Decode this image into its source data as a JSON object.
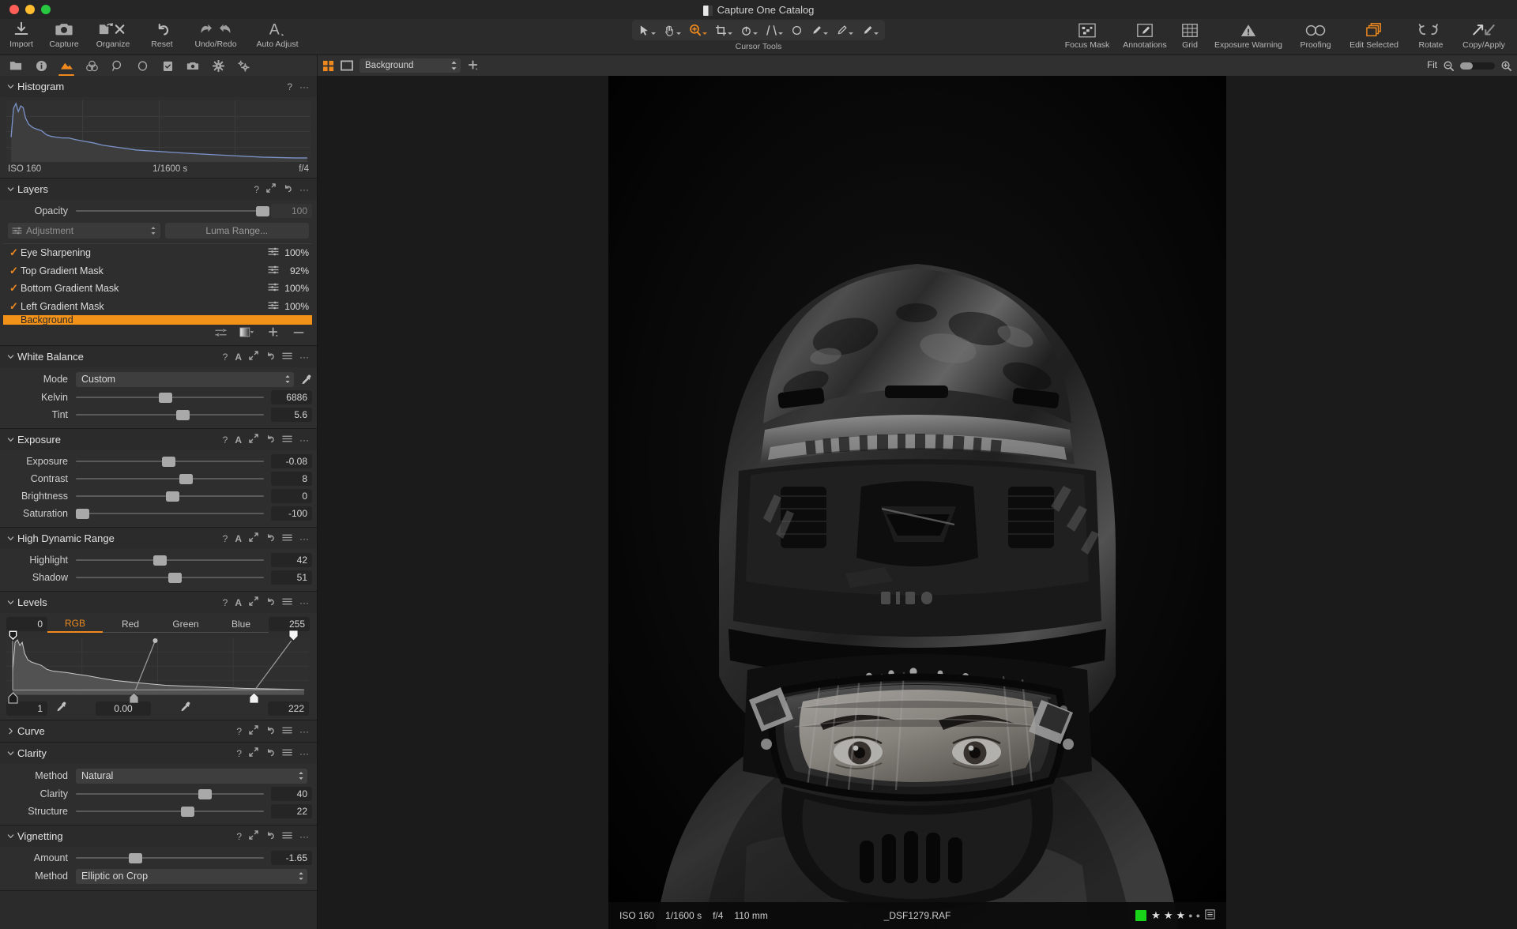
{
  "window": {
    "title": "Capture One Catalog",
    "app_icon": "capture-one-icon"
  },
  "toolbar": {
    "left_items": [
      {
        "label": "Import",
        "icon": "import-icon"
      },
      {
        "label": "Capture",
        "icon": "camera-icon"
      },
      {
        "label": "Organize",
        "icon": "organize-icon"
      },
      {
        "label": "Reset",
        "icon": "reset-arrow-icon"
      },
      {
        "label": "Undo/Redo",
        "icon": "undo-redo-icon"
      },
      {
        "label": "Auto Adjust",
        "icon": "auto-adjust-a-icon"
      }
    ],
    "cursor_tools_label": "Cursor Tools",
    "cursor_tools": [
      {
        "icon": "pointer-icon",
        "active": false
      },
      {
        "icon": "pan-hand-icon",
        "active": false
      },
      {
        "icon": "zoom-in-loupe-icon",
        "active": true
      },
      {
        "icon": "crop-icon",
        "active": false
      },
      {
        "icon": "rotate-crop-icon",
        "active": false
      },
      {
        "icon": "keystone-icon",
        "active": false
      },
      {
        "icon": "spot-removal-icon",
        "active": false
      },
      {
        "icon": "draw-mask-brush-icon",
        "active": false
      },
      {
        "icon": "erase-mask-brush-icon",
        "active": false
      },
      {
        "icon": "gradient-mask-icon",
        "active": false
      },
      {
        "icon": "color-editor-picker-icon",
        "active": false
      }
    ],
    "right_items": [
      {
        "label": "Focus Mask",
        "icon": "focus-mask-icon",
        "active": false
      },
      {
        "label": "Annotations",
        "icon": "annotations-pencil-icon",
        "active": false
      },
      {
        "label": "Grid",
        "icon": "grid-icon",
        "active": false
      },
      {
        "label": "Exposure Warning",
        "icon": "exposure-warning-icon",
        "active": false
      },
      {
        "label": "Proofing",
        "icon": "proofing-glasses-icon",
        "active": false
      },
      {
        "label": "Edit Selected",
        "icon": "edit-selected-stack-icon",
        "active": true
      },
      {
        "label": "Rotate",
        "icon": "rotate-icon",
        "active": false
      },
      {
        "label": "Copy/Apply",
        "icon": "copy-apply-arrows-icon",
        "active": false
      }
    ]
  },
  "tool_tabs": [
    {
      "name": "library-tab",
      "icon": "folder-icon",
      "active": false
    },
    {
      "name": "capture-tab",
      "icon": "info-circle-icon",
      "active": false
    },
    {
      "name": "lens-tab",
      "icon": "exposure-mountain-icon",
      "active": true
    },
    {
      "name": "color-tab",
      "icon": "color-rings-icon",
      "active": false
    },
    {
      "name": "details-tab",
      "icon": "loupe-icon",
      "active": false
    },
    {
      "name": "styles-tab",
      "icon": "circle-icon",
      "active": false
    },
    {
      "name": "adjustments-tab",
      "icon": "clipboard-check-icon",
      "active": false
    },
    {
      "name": "metadata-tab",
      "icon": "camera-small-icon",
      "active": false
    },
    {
      "name": "output-tab",
      "icon": "gear-icon",
      "active": false
    },
    {
      "name": "batch-tab",
      "icon": "gears-icon",
      "active": false
    }
  ],
  "viewer_bar": {
    "grid_view_icon": "grid-view-icon",
    "single_view_icon": "single-view-icon",
    "background_label": "Background",
    "add_icon": "plus-icon",
    "fit_label": "Fit",
    "zoom_out_icon": "zoom-out-icon",
    "zoom_in_icon": "zoom-in-icon",
    "zoom_value": 12
  },
  "panels": {
    "histogram": {
      "title": "Histogram",
      "actions": [
        "?",
        "..."
      ],
      "iso": "ISO 160",
      "shutter": "1/1600 s",
      "aperture": "f/4"
    },
    "layers": {
      "title": "Layers",
      "actions": [
        "?",
        "expand",
        "reset",
        "..."
      ],
      "opacity_label": "Opacity",
      "opacity_value": "100",
      "adjustment_label": "Adjustment",
      "luma_range_label": "Luma Range...",
      "items": [
        {
          "name": "Eye Sharpening",
          "opacity": "100%",
          "checked": true,
          "selected": false
        },
        {
          "name": "Top Gradient Mask",
          "opacity": "92%",
          "checked": true,
          "selected": false
        },
        {
          "name": "Bottom Gradient Mask",
          "opacity": "100%",
          "checked": true,
          "selected": false
        },
        {
          "name": "Left Gradient Mask",
          "opacity": "100%",
          "checked": true,
          "selected": false
        },
        {
          "name": "Background",
          "opacity": "",
          "checked": false,
          "selected": true
        }
      ],
      "footer_icons": [
        "mask-settings-icon",
        "mask-display-icon",
        "add-layer-icon",
        "remove-layer-icon"
      ]
    },
    "white_balance": {
      "title": "White Balance",
      "actions": [
        "?",
        "A",
        "expand",
        "reset",
        "menu",
        "..."
      ],
      "mode_label": "Mode",
      "mode_value": "Custom",
      "kelvin_label": "Kelvin",
      "kelvin_value": "6886",
      "tint_label": "Tint",
      "tint_value": "5.6"
    },
    "exposure": {
      "title": "Exposure",
      "actions": [
        "?",
        "A",
        "expand",
        "reset",
        "menu",
        "..."
      ],
      "sliders": [
        {
          "label": "Exposure",
          "value": "-0.08",
          "pos": 45
        },
        {
          "label": "Contrast",
          "value": "8",
          "pos": 55
        },
        {
          "label": "Brightness",
          "value": "0",
          "pos": 50
        },
        {
          "label": "Saturation",
          "value": "-100",
          "pos": 2
        }
      ]
    },
    "hdr": {
      "title": "High Dynamic Range",
      "actions": [
        "?",
        "A",
        "expand",
        "reset",
        "menu",
        "..."
      ],
      "sliders": [
        {
          "label": "Highlight",
          "value": "42",
          "pos": 42
        },
        {
          "label": "Shadow",
          "value": "51",
          "pos": 51
        }
      ]
    },
    "levels": {
      "title": "Levels",
      "actions": [
        "?",
        "A",
        "expand",
        "reset",
        "menu",
        "..."
      ],
      "input_black": "0",
      "input_white": "255",
      "channels": [
        {
          "label": "RGB",
          "active": true
        },
        {
          "label": "Red",
          "active": false
        },
        {
          "label": "Green",
          "active": false
        },
        {
          "label": "Blue",
          "active": false
        }
      ],
      "output_black": "1",
      "midtone": "0.00",
      "output_white": "222"
    },
    "curve": {
      "title": "Curve",
      "collapsed": true,
      "actions": [
        "?",
        "expand",
        "reset",
        "menu",
        "..."
      ]
    },
    "clarity": {
      "title": "Clarity",
      "actions": [
        "?",
        "expand",
        "reset",
        "menu",
        "..."
      ],
      "method_label": "Method",
      "method_value": "Natural",
      "sliders": [
        {
          "label": "Clarity",
          "value": "40",
          "pos": 67
        },
        {
          "label": "Structure",
          "value": "22",
          "pos": 58
        }
      ]
    },
    "vignetting": {
      "title": "Vignetting",
      "actions": [
        "?",
        "expand",
        "reset",
        "menu",
        "..."
      ],
      "amount_label": "Amount",
      "amount_value": "-1.65",
      "method_label": "Method",
      "method_value": "Elliptic on Crop"
    }
  },
  "status_bar": {
    "iso": "ISO 160",
    "shutter": "1/1600 s",
    "aperture": "f/4",
    "focal": "110 mm",
    "filename": "_DSF1279.RAF",
    "color_tag": "#18d318",
    "rating": 3,
    "rating_max": 5,
    "metadata_icon": "metadata-list-icon"
  },
  "colors": {
    "accent": "#f08a1e",
    "panel_bg": "#2e2e2e",
    "toolbar_bg": "#2b2b2b",
    "viewer_bg": "#1b1b1b"
  },
  "photo": {
    "subject": "portrait of a mountain biker wearing a full-face helmet and goggles, black and white"
  }
}
